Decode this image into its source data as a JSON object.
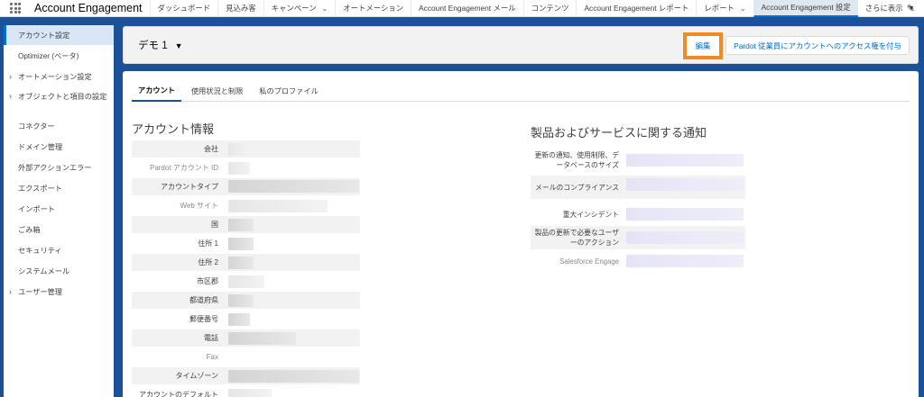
{
  "app": {
    "name": "Account Engagement"
  },
  "nav": {
    "items": [
      {
        "label": "ダッシュボード"
      },
      {
        "label": "見込み客"
      },
      {
        "label": "キャンペーン",
        "chevron": true
      },
      {
        "label": "オートメーション"
      },
      {
        "label": "Account Engagement メール"
      },
      {
        "label": "コンテンツ"
      },
      {
        "label": "Account Engagement レポート"
      },
      {
        "label": "レポート",
        "chevron": true
      },
      {
        "label": "Account Engagement 設定",
        "active": true
      }
    ],
    "more_label": "さらに表示"
  },
  "sidebar": {
    "items": [
      {
        "label": "アカウント設定",
        "active": true
      },
      {
        "label": "Optimizer (ベータ)"
      },
      {
        "label": "オートメーション設定",
        "expandable": true
      },
      {
        "label": "オブジェクトと項目の設定",
        "expandable": true
      },
      {
        "label": "コネクター"
      },
      {
        "label": "ドメイン管理"
      },
      {
        "label": "外部アクションエラー"
      },
      {
        "label": "エクスポート"
      },
      {
        "label": "インポート"
      },
      {
        "label": "ごみ箱"
      },
      {
        "label": "セキュリティ"
      },
      {
        "label": "システムメール"
      },
      {
        "label": "ユーザー管理",
        "expandable": true
      }
    ]
  },
  "header": {
    "title": "デモ 1",
    "edit_label": "編集",
    "grant_label": "Pardot 従業員にアカウントへのアクセス権を付与"
  },
  "tabs": [
    "アカウント",
    "使用状況と制限",
    "私のプロファイル"
  ],
  "account_info": {
    "title": "アカウント情報",
    "fields": [
      "会社",
      "Pardot アカウント ID",
      "アカウントタイプ",
      "Web サイト",
      "国",
      "住所 1",
      "住所 2",
      "市区郡",
      "都道府県",
      "郵便番号",
      "電話",
      "Fax",
      "タイムゾーン",
      "アカウントのデフォルト"
    ]
  },
  "notifications": {
    "title": "製品およびサービスに関する通知",
    "fields": [
      "更新の通知、使用制限、データベースのサイズ",
      "メールのコンプライアンス",
      "重大インシデント",
      "製品の更新で必要なユーザーのアクション",
      "Salesforce Engage"
    ]
  },
  "colors": {
    "brand": "#1b5297",
    "accent": "#0070d2",
    "highlight": "#f08a24"
  },
  "icons": {
    "app_launcher": "waffle-icon",
    "edit_nav": "pencil-icon",
    "dropdown": "chevron-down-icon"
  }
}
